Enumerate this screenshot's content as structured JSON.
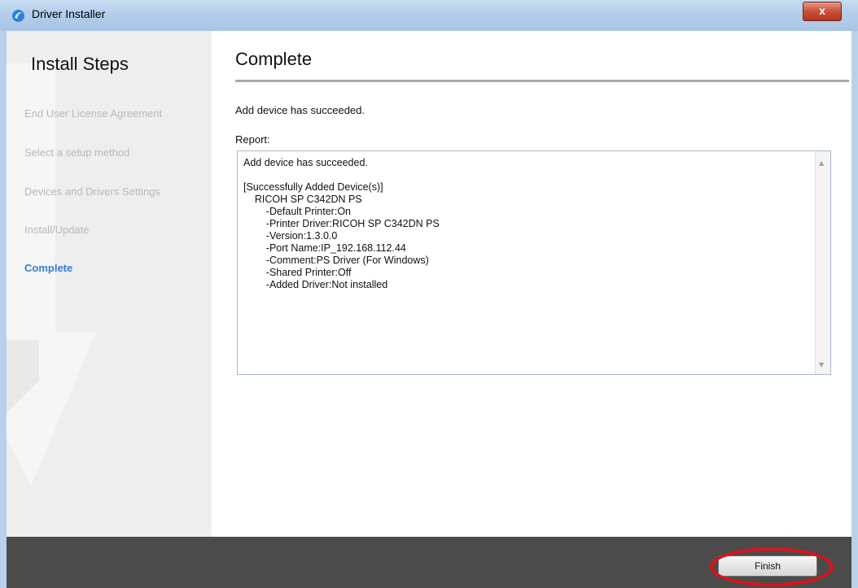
{
  "window": {
    "title": "Driver Installer",
    "close_label": "x"
  },
  "sidebar": {
    "title": "Install Steps",
    "steps": [
      {
        "label": "End User License Agreement",
        "active": false
      },
      {
        "label": "Select a setup method",
        "active": false
      },
      {
        "label": "Devices and Drivers Settings",
        "active": false
      },
      {
        "label": "Install/Update",
        "active": false
      },
      {
        "label": "Complete",
        "active": true
      }
    ]
  },
  "main": {
    "title": "Complete",
    "status_message": "Add device has succeeded.",
    "report_label": "Report:",
    "report_lines": [
      "Add device has succeeded.",
      "",
      "[Successfully Added Device(s)]",
      "    RICOH SP C342DN PS",
      "        -Default Printer:On",
      "        -Printer Driver:RICOH SP C342DN PS",
      "        -Version:1.3.0.0",
      "        -Port Name:IP_192.168.112.44",
      "        -Comment:PS Driver (For Windows)",
      "        -Shared Printer:Off",
      "        -Added Driver:Not installed"
    ]
  },
  "footer": {
    "finish_label": "Finish"
  },
  "colors": {
    "accent": "#3a7bd5",
    "footer_bg": "#4b4b4b",
    "highlight": "#e0101a"
  }
}
